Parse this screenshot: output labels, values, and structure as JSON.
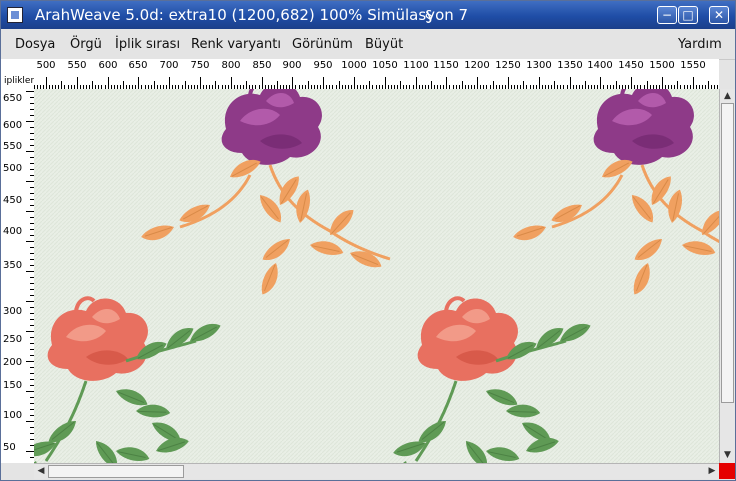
{
  "window": {
    "title": "ArahWeave 5.0d: extra10 (1200,682) 100% Simülasyon 7",
    "swirl_glyph": "§",
    "minimize_glyph": "−",
    "maximize_glyph": "□",
    "close_glyph": "✕"
  },
  "menu": {
    "items": [
      "Dosya",
      "Örgü",
      "İplik sırası",
      "Renk varyantı",
      "Görünüm",
      "Büyüt"
    ],
    "help": "Yardım"
  },
  "ruler": {
    "corner_label": "iplikler",
    "x_labels": [
      "500",
      "550",
      "600",
      "650",
      "700",
      "750",
      "800",
      "850",
      "900",
      "950",
      "1000",
      "1050",
      "1100",
      "1150",
      "1200",
      "1250",
      "1300",
      "1350",
      "1400",
      "1450",
      "1500",
      "1550"
    ],
    "y_labels": [
      "650",
      "600",
      "550",
      "500",
      "450",
      "400",
      "350",
      "300",
      "250",
      "200",
      "150",
      "100",
      "50"
    ]
  },
  "fabric": {
    "background_color": "#e9efe6",
    "pattern": "rose motifs",
    "colors": {
      "purple": "#8e3a88",
      "orange": "#f0a060",
      "red": "#e87060",
      "green": "#5f9a55"
    }
  },
  "scrollbars": {
    "up_glyph": "▲",
    "down_glyph": "▼",
    "left_glyph": "◀",
    "right_glyph": "▶"
  },
  "status_color": "#e50000"
}
